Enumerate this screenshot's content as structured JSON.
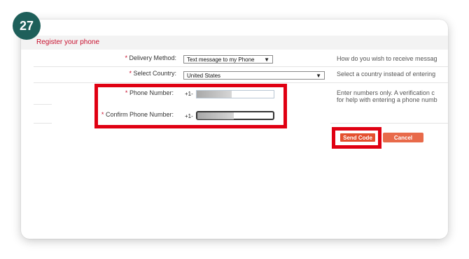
{
  "step": {
    "number": "27"
  },
  "section": {
    "title": "Register your phone"
  },
  "form": {
    "delivery_method": {
      "label": "Delivery Method:",
      "value": "Text message to my Phone",
      "help": "How do you wish to receive messag"
    },
    "select_country": {
      "label": "Select Country:",
      "value": "United States",
      "help": "Select a country instead of entering"
    },
    "phone_number": {
      "label": "Phone Number:",
      "prefix": "+1-",
      "help_line1": "Enter numbers only. A verification c",
      "help_line2": "for help with entering a phone numb"
    },
    "confirm_phone_number": {
      "label": "Confirm Phone Number:",
      "prefix": "+1-"
    },
    "required_marker": "*"
  },
  "buttons": {
    "send_code": "Send Code",
    "cancel": "Cancel"
  },
  "colors": {
    "badge": "#1e5f5a",
    "highlight": "#e00012",
    "section_title": "#c8102e",
    "button": "#e4502f"
  }
}
